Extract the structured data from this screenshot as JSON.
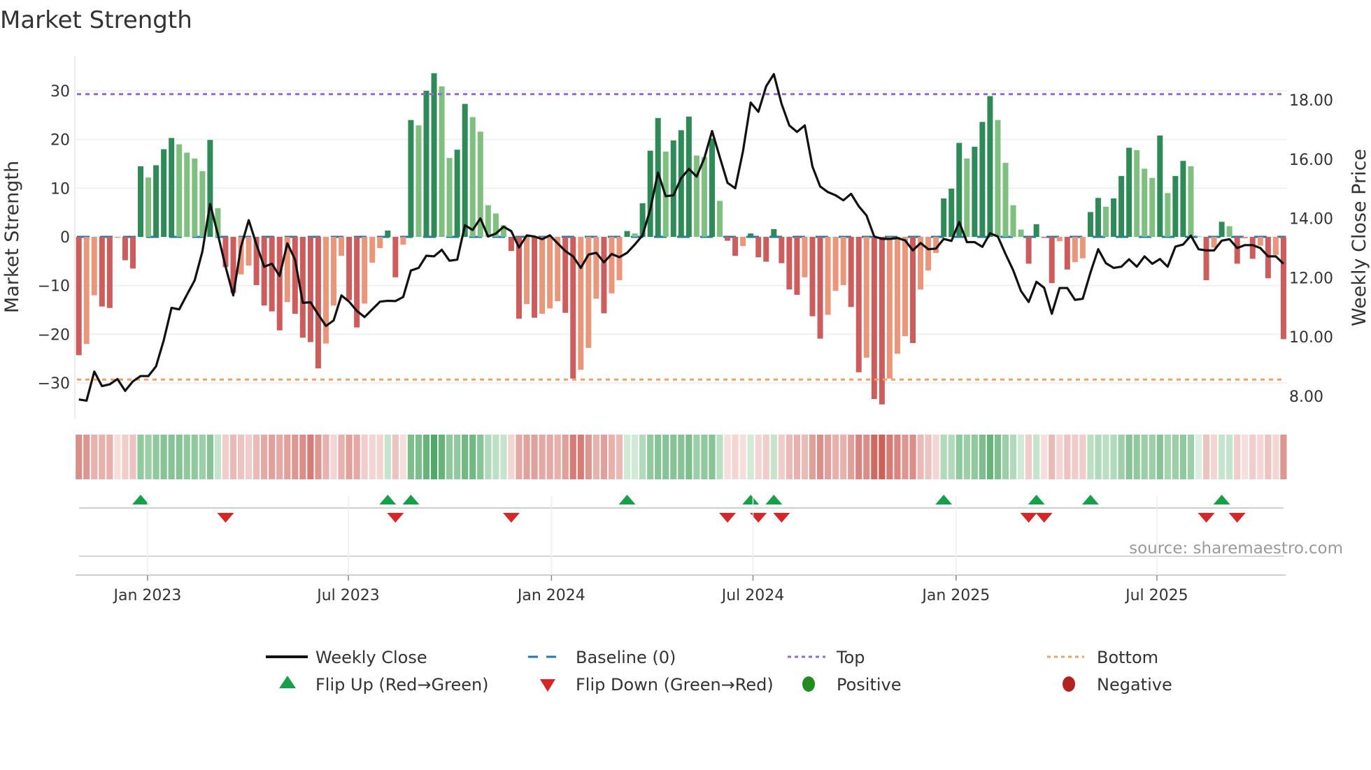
{
  "chart_data": {
    "type": "bar",
    "title": "Market Strength",
    "ylabel": "Market Strength",
    "y2label": "Weekly Close Price",
    "ylim": [
      -37,
      37
    ],
    "y2lim": [
      7.2,
      19.5
    ],
    "yticks": [
      30,
      20,
      10,
      0,
      -10,
      -20,
      -30
    ],
    "ytick_labels": [
      "30",
      "20",
      "10",
      "0",
      "−10",
      "−20",
      "−30"
    ],
    "y2ticks": [
      18,
      16,
      14,
      12,
      10,
      8
    ],
    "y2tick_labels": [
      "18.00",
      "16.00",
      "14.00",
      "12.00",
      "10.00",
      "8.00"
    ],
    "top_level": 29.3,
    "bottom_level": -29.3,
    "baseline": 0,
    "grid": true,
    "xticks": [
      {
        "week_index": 8.9,
        "label": "Jan 2023"
      },
      {
        "week_index": 34.9,
        "label": "Jul 2023"
      },
      {
        "week_index": 61.2,
        "label": "Jan 2024"
      },
      {
        "week_index": 87.3,
        "label": "Jul 2024"
      },
      {
        "week_index": 113.6,
        "label": "Jan 2025"
      },
      {
        "week_index": 139.6,
        "label": "Jul 2025"
      }
    ],
    "strength": [
      -24.3,
      -22,
      -12,
      -14.3,
      -14.6,
      -0.2,
      -4.8,
      -6.5,
      14.5,
      12.2,
      14.7,
      18,
      20.3,
      19,
      17.3,
      16.1,
      13.5,
      19.9,
      5.9,
      -6.2,
      -11.5,
      -7.7,
      -5.9,
      -9.9,
      -14.1,
      -15.3,
      -19.2,
      -13.4,
      -15.8,
      -20.7,
      -21.6,
      -27,
      -21.9,
      -14.1,
      -3.9,
      -13,
      -18.6,
      -13.7,
      -5.3,
      -2.3,
      1.3,
      -8.3,
      -1.6,
      24,
      22.9,
      30,
      33.6,
      30.9,
      16.2,
      17.9,
      27.3,
      24.6,
      21.6,
      6.5,
      4.8,
      2.4,
      -2.9,
      -16.8,
      -13.8,
      -16.6,
      -15.8,
      -14.7,
      -13.2,
      -15.6,
      -29.1,
      -27.3,
      -22.8,
      -12.7,
      -15.7,
      -11.6,
      -8.9,
      1.2,
      0.7,
      6.9,
      17.7,
      24.4,
      17.5,
      19.8,
      21.9,
      24.7,
      16.7,
      16.4,
      20.2,
      7.4,
      -0.8,
      -3.9,
      -1.9,
      0.7,
      -4.2,
      -5.1,
      1.6,
      -5.4,
      -10.8,
      -11.9,
      -8.3,
      -16.3,
      -20.9,
      -16,
      -11.1,
      -9.9,
      -14.4,
      -27.8,
      -24.8,
      -33.3,
      -34.4,
      -29.1,
      -24,
      -20.4,
      -21.8,
      -10.8,
      -6.9,
      -3.3,
      7.9,
      9.9,
      19.3,
      16.1,
      18.5,
      23.6,
      28.9,
      24,
      15.2,
      6.5,
      1.5,
      -5.5,
      2.6,
      -0.2,
      -9.5,
      -0.9,
      -6.7,
      -5.2,
      -4.4,
      5.1,
      8,
      6.2,
      7.9,
      12.5,
      18.3,
      17.8,
      14,
      12.1,
      20.8,
      9,
      12.5,
      15.6,
      14.5,
      0.1,
      -8.9,
      -2.2,
      3.1,
      2.2,
      -5.5,
      -0.3,
      -4.5,
      -1.8,
      -8.5,
      -3.7,
      -21
    ],
    "weekly_close": [
      7.89,
      7.85,
      8.83,
      8.34,
      8.4,
      8.58,
      8.18,
      8.5,
      8.68,
      8.68,
      9.01,
      9.89,
      10.98,
      10.93,
      11.43,
      11.91,
      12.88,
      14.49,
      13.47,
      12.37,
      11.4,
      13.04,
      13.94,
      13.12,
      12.37,
      12.47,
      12.06,
      13.16,
      12.61,
      11.15,
      11.17,
      10.76,
      10.37,
      10.56,
      11.4,
      11.19,
      10.88,
      10.67,
      10.93,
      11.19,
      11.22,
      11.21,
      11.35,
      12.24,
      12.33,
      12.74,
      12.72,
      12.94,
      12.57,
      12.61,
      13.77,
      13.61,
      14.0,
      13.39,
      13.49,
      13.72,
      13.57,
      13.02,
      13.43,
      13.39,
      13.3,
      13.43,
      13.16,
      12.9,
      12.72,
      12.33,
      12.78,
      12.84,
      12.52,
      12.8,
      12.69,
      12.84,
      13.12,
      13.43,
      14.31,
      15.55,
      14.75,
      14.78,
      15.36,
      15.67,
      15.41,
      16.03,
      16.95,
      16.07,
      15.2,
      15.02,
      16.26,
      17.91,
      17.6,
      18.46,
      18.87,
      17.87,
      17.14,
      16.92,
      17.14,
      15.75,
      15.08,
      14.89,
      14.78,
      14.61,
      14.83,
      14.41,
      14.1,
      13.39,
      13.31,
      13.31,
      13.34,
      13.26,
      12.92,
      13.17,
      12.96,
      12.98,
      13.31,
      13.24,
      13.88,
      13.2,
      13.2,
      13.04,
      13.5,
      13.39,
      12.8,
      12.25,
      11.55,
      11.18,
      11.86,
      11.66,
      10.78,
      11.65,
      11.65,
      11.25,
      11.29,
      12.17,
      12.96,
      12.49,
      12.33,
      12.37,
      12.62,
      12.37,
      12.72,
      12.47,
      12.63,
      12.37,
      13.05,
      13.12,
      13.42,
      12.96,
      12.92,
      12.92,
      13.25,
      13.3,
      13.0,
      13.1,
      13.1,
      13.0,
      12.72,
      12.72,
      12.47
    ],
    "heat_strip": [
      -0.55,
      -0.5,
      -0.35,
      -0.35,
      -0.35,
      -0.1,
      -0.2,
      -0.25,
      0.45,
      0.4,
      0.45,
      0.5,
      0.5,
      0.5,
      0.45,
      0.45,
      0.4,
      0.5,
      0.2,
      -0.2,
      -0.3,
      -0.25,
      -0.2,
      -0.3,
      -0.4,
      -0.45,
      -0.4,
      -0.45,
      -0.5,
      -0.55,
      -0.65,
      -0.5,
      -0.35,
      -0.15,
      -0.35,
      -0.45,
      -0.4,
      -0.2,
      -0.15,
      -0.15,
      0.2,
      -0.25,
      -0.1,
      0.55,
      0.55,
      0.65,
      0.75,
      0.65,
      0.45,
      0.45,
      0.6,
      0.6,
      0.5,
      0.3,
      0.25,
      0.2,
      -0.15,
      -0.4,
      -0.45,
      -0.45,
      -0.4,
      -0.4,
      -0.35,
      -0.45,
      -0.65,
      -0.65,
      -0.5,
      -0.35,
      -0.45,
      -0.35,
      -0.3,
      0.15,
      0.15,
      0.3,
      0.45,
      0.5,
      0.5,
      0.5,
      0.5,
      0.55,
      0.4,
      0.45,
      0.5,
      0.25,
      -0.1,
      -0.15,
      -0.1,
      0.15,
      -0.15,
      -0.2,
      0.2,
      -0.2,
      -0.3,
      -0.35,
      -0.3,
      -0.45,
      -0.55,
      -0.45,
      -0.35,
      -0.35,
      -0.45,
      -0.6,
      -0.55,
      -0.75,
      -0.8,
      -0.65,
      -0.6,
      -0.5,
      -0.55,
      -0.3,
      -0.25,
      -0.15,
      0.3,
      0.3,
      0.45,
      0.4,
      0.45,
      0.55,
      0.65,
      0.55,
      0.4,
      0.3,
      0.15,
      -0.2,
      0.2,
      -0.1,
      -0.3,
      -0.15,
      -0.25,
      -0.2,
      -0.2,
      0.25,
      0.3,
      0.25,
      0.3,
      0.4,
      0.5,
      0.45,
      0.4,
      0.4,
      0.5,
      0.35,
      0.4,
      0.45,
      0.4,
      0.1,
      -0.25,
      -0.15,
      0.2,
      0.2,
      -0.2,
      -0.1,
      -0.2,
      -0.15,
      -0.25,
      -0.15,
      -0.5
    ],
    "flip_up_weeks": [
      9,
      41,
      44,
      72,
      88,
      91,
      113,
      125,
      132,
      149
    ],
    "flip_down_weeks": [
      20,
      42,
      57,
      85,
      89,
      92,
      124,
      126,
      147,
      151
    ],
    "colors": {
      "strong_up": "#2e8b57",
      "weak_up": "#7fbf7f",
      "strong_down": "#cd5c5c",
      "weak_down": "#e9967a",
      "line": "#111111",
      "baseline": "#1f77b4",
      "top": "#9467d4",
      "bottom": "#f0a060",
      "flip_up": "#16a04a",
      "flip_down": "#d62728",
      "positive": "#228b22",
      "negative": "#b22222"
    },
    "legend": {
      "placement": "bottom",
      "items": [
        "Weekly Close",
        "Baseline (0)",
        "Top",
        "Bottom",
        "Flip Up (Red→Green)",
        "Flip Down (Green→Red)",
        "Positive",
        "Negative"
      ]
    },
    "source": "source: sharemaestro.com"
  }
}
